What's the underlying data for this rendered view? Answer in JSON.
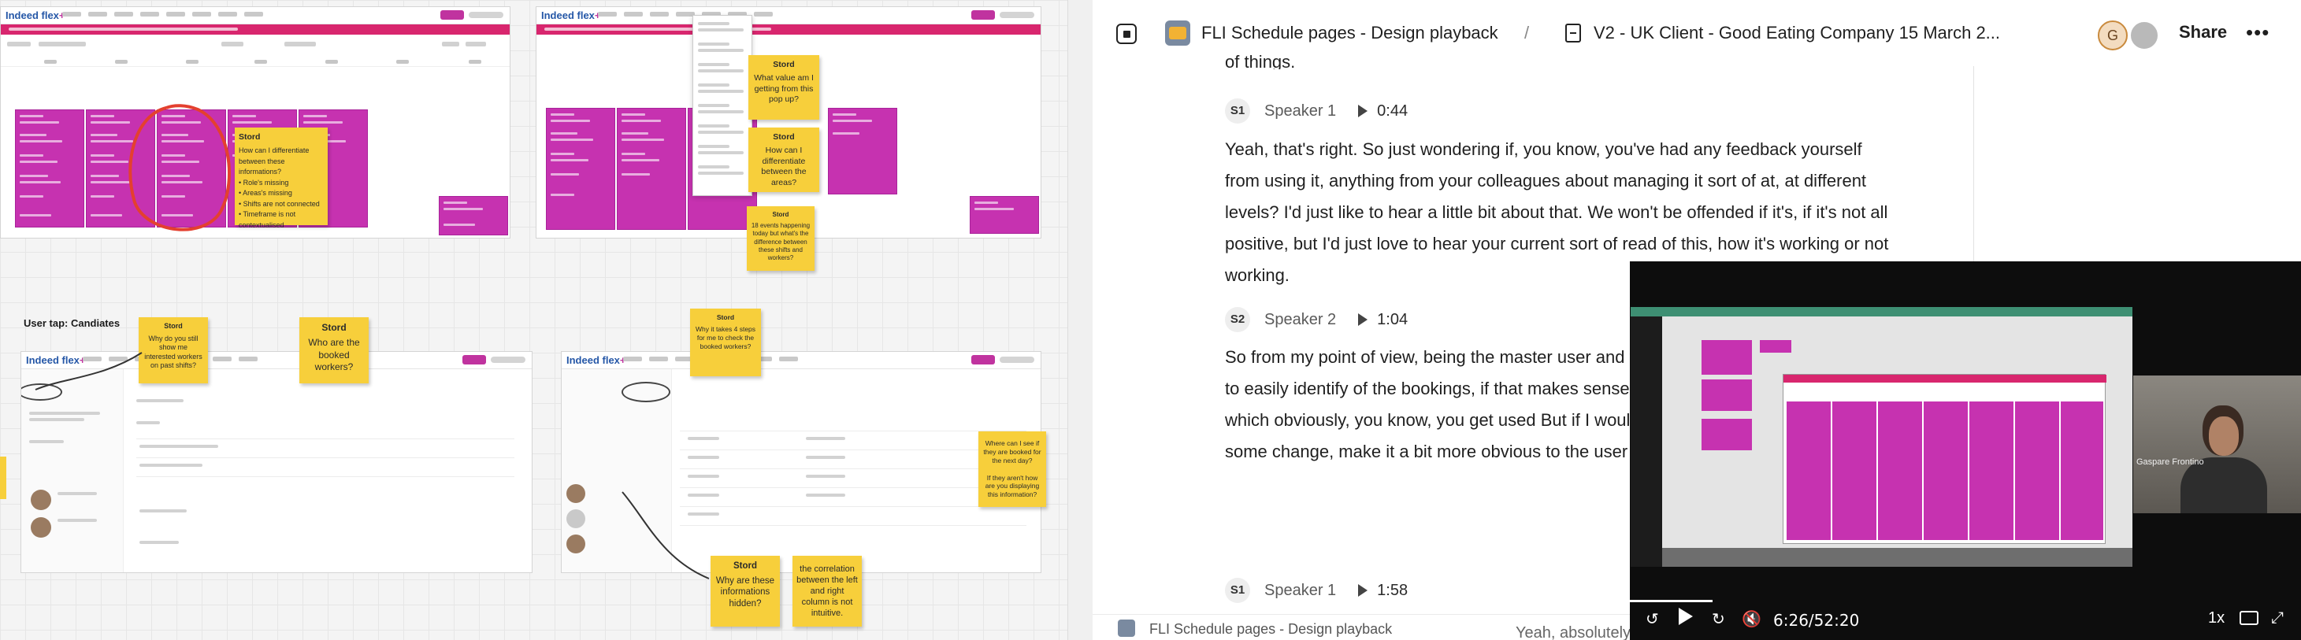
{
  "board": {
    "brand": "Indeed flex",
    "brand_plus": "+",
    "section_candidates": "User tap: Candiates",
    "stickies": [
      {
        "head": "Stord",
        "body": "How can I differentiate between these informations?\n• Role's missing\n• Areas's missing\n• Shifts are not connected\n• Timeframe is not contextualised"
      },
      {
        "head": "Stord",
        "body": "What value am I getting from this pop up?"
      },
      {
        "head": "Stord",
        "body": "How can I differentiate between the areas?"
      },
      {
        "head": "Stord",
        "body": "18 events happening today but what's the difference between these shifts and workers?"
      },
      {
        "head": "Stord",
        "body": "Why do you still show me interested workers on past shifts?"
      },
      {
        "head": "Stord",
        "body": "Who are the booked workers?"
      },
      {
        "head": "Stord",
        "body": "Why it takes 4 steps for me to check the booked workers?"
      },
      {
        "head": "",
        "body": "Where can I see if they are booked for the next day?\n\nIf they aren't how are you displaying this information?"
      },
      {
        "head": "Stord",
        "body": "Why are these informations hidden?"
      },
      {
        "head": "",
        "body": "the correlation between the left and right column is not intuitive."
      }
    ]
  },
  "header": {
    "board_title": "FLI Schedule pages - Design playback",
    "separator": "/",
    "doc_title": "V2 - UK Client - Good Eating Company 15 March 2...",
    "avatar_initial": "G",
    "share_label": "Share",
    "more_label": "•••"
  },
  "transcript": {
    "prev_cut": "of things.",
    "entries": [
      {
        "badge": "S1",
        "speaker": "Speaker 1",
        "time": "0:44",
        "text": "Yeah, that's right. So just wondering if, you know, you've had any feedback yourself from using it, anything from your colleagues about managing it sort of at, at different levels? I'd just like to hear a little bit about that. We won't be offended if it's, if it's not all positive, but I'd just love to hear your current sort of read of this, how it's working or not working."
      },
      {
        "badge": "S2",
        "speaker": "Speaker 2",
        "time": "1:04",
        "text": "So from my point of view, being the master user and that schedule, the main difficulty is to easily identify of the bookings, if that makes sense. Yes, no, absolutely challenge, which obviously, you know, you get used But if I would, if, if I change, if I was to change some change, make it a bit more obvious to the user what basically."
      },
      {
        "badge": "S1",
        "speaker": "Speaker 1",
        "time": "1:58"
      }
    ]
  },
  "footer": {
    "board_title": "FLI Schedule pages - Design playback",
    "cut_text": "Yeah, absolutely. Yeah. Ur, tomasse, so"
  },
  "video": {
    "time": "6:26/52:20",
    "speed": "1x",
    "participant": "Gaspare Frontino",
    "progress": 0.123
  }
}
